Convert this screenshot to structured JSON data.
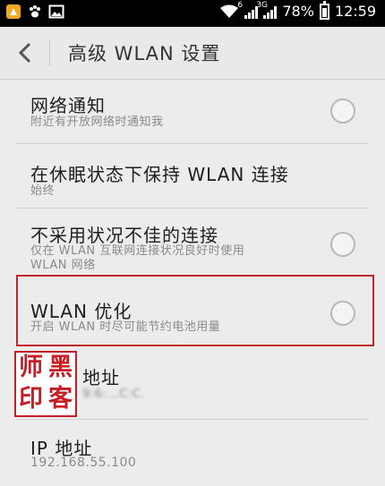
{
  "status_bar": {
    "icons": [
      "rabbit-icon",
      "paw-icon",
      "image-icon",
      "wifi-icon",
      "signal-icon",
      "signal-3g-icon",
      "battery-icon"
    ],
    "signal_tag_1": "6",
    "signal_tag_2": "3G",
    "battery_percent": "78%",
    "battery_level": 0.78,
    "time": "12:59"
  },
  "header": {
    "title": "高级 WLAN 设置"
  },
  "settings": [
    {
      "title": "网络通知",
      "subtitle": "附近有开放网络时通知我",
      "has_radio": true
    },
    {
      "title": "在休眠状态下保持 WLAN 连接",
      "subtitle": "始终",
      "has_radio": false
    },
    {
      "title": "不采用状况不佳的连接",
      "subtitle_line1": "仅在 WLAN 互联网连接状况良好时使用",
      "subtitle_line2": "WLAN 网络",
      "has_radio": true
    },
    {
      "title": "WLAN 优化",
      "subtitle": "开启 WLAN 时尽可能节约电池用量",
      "has_radio": true
    },
    {
      "title": "地址",
      "subtitle": "9:6:...C:C."
    },
    {
      "title": "IP 地址",
      "subtitle": "192.168.55.100"
    }
  ],
  "watermark": {
    "chars": [
      "师",
      "黑",
      "印",
      "客"
    ]
  },
  "colors": {
    "highlight": "#c0262b",
    "stamp": "#c51f25"
  }
}
